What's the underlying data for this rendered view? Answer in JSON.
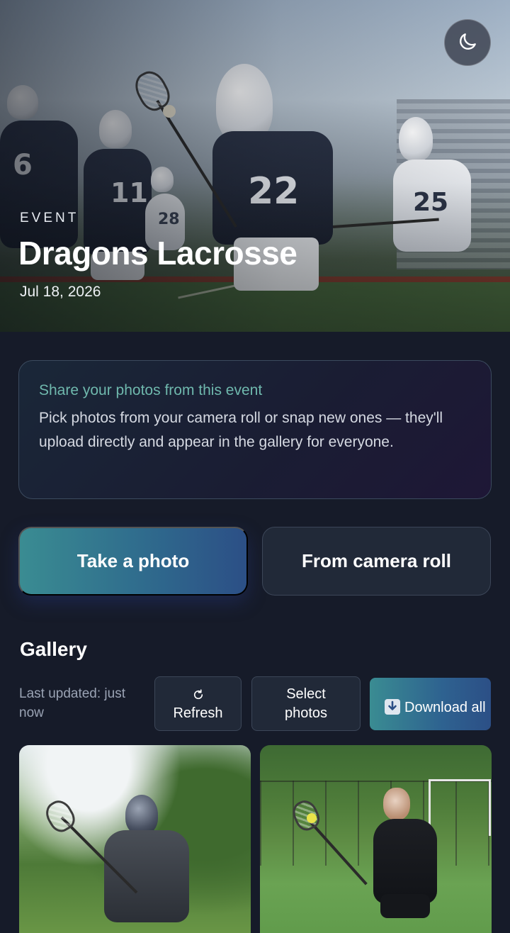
{
  "colors": {
    "background": "#161b29",
    "accent_gradient_start": "#3a8c92",
    "accent_gradient_end": "#2c4f86",
    "info_title": "#6fb8ad",
    "muted_text": "#9aa3b4"
  },
  "header": {
    "theme_toggle_icon": "moon-icon",
    "eyebrow": "EVENT",
    "title": "Dragons Lacrosse",
    "date": "Jul 18, 2026"
  },
  "info_card": {
    "title": "Share your photos from this event",
    "body": "Pick photos from your camera roll or snap new ones — they'll upload directly and appear in the gallery for everyone."
  },
  "actions": {
    "take_photo": "Take a photo",
    "camera_roll": "From camera roll"
  },
  "gallery": {
    "title": "Gallery",
    "last_updated": "Last updated: just now",
    "refresh_icon": "refresh-icon",
    "refresh_label": "Refresh",
    "select_label": "Select photos",
    "download_icon": "download-icon",
    "download_label": "Download all"
  }
}
